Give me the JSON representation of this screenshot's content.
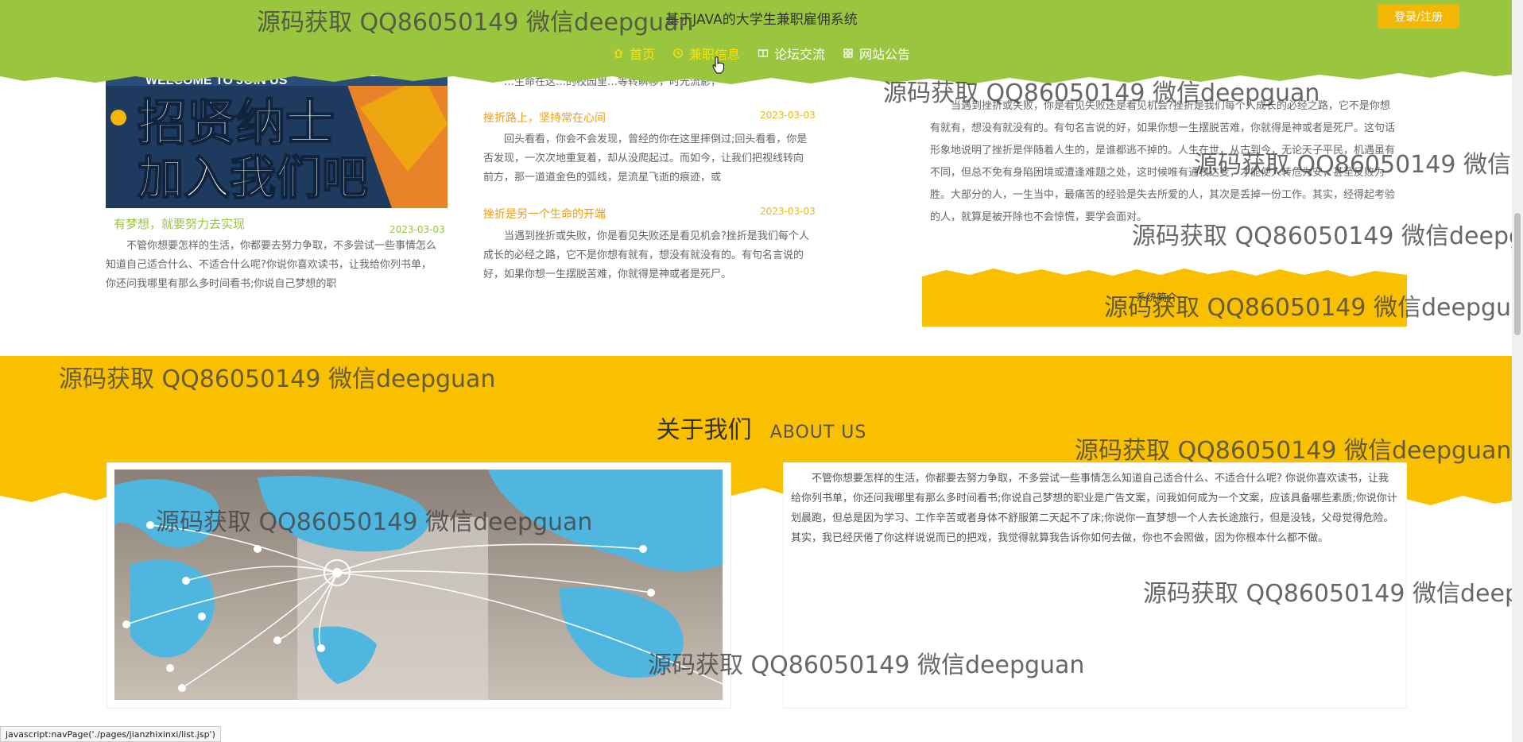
{
  "header": {
    "title": "基于JAVA的大学生兼职雇佣系统",
    "login_label": "登录/注册",
    "nav": [
      {
        "label": "首页",
        "icon": "home-icon"
      },
      {
        "label": "兼职信息",
        "icon": "clock-icon"
      },
      {
        "label": "论坛交流",
        "icon": "book-icon"
      },
      {
        "label": "网站公告",
        "icon": "grid-icon"
      }
    ],
    "active_nav": 1
  },
  "featured": {
    "image_text_top": "WELCOME TO JOIN US",
    "image_text_line1": "招贤纳士",
    "image_text_line2": "加入我们吧",
    "title": "有梦想，就要努力去实现",
    "date": "2023-03-03",
    "text": "不管你想要怎样的生活，你都要去努力争取，不多尝试一些事情怎么知道自己适合什么、不适合什么呢?你说你喜欢读书，让我给你列书单，你还问我哪里有那么多时间看书;你说自己梦想的职"
  },
  "news": [
    {
      "title": "",
      "date": "",
      "text": "…生命在这…的校园里…等转瞬移，时光流影，"
    },
    {
      "title": "挫折路上，坚持常在心间",
      "date": "2023-03-03",
      "text": "回头看看，你会不会发现，曾经的你在这里摔倒过;回头看看，你是否发现，一次次地重复着，却从没爬起过。而如今，让我们把视线转向前方，那一道道金色的弧线，是流星飞逝的痕迹，或"
    },
    {
      "title": "挫折是另一个生命的开端",
      "date": "2023-03-03",
      "text": "当遇到挫折或失败，你是看见失败还是看见机会?挫折是我们每个人成长的必经之路，它不是你想有就有，想没有就没有的。有句名言说的好，如果你想一生摆脱苦难，你就得是神或者是死尸。"
    }
  ],
  "story": {
    "text": "当遇到挫折或失败，你是看见失败还是看见机会?挫折是我们每个人成长的必经之路，它不是你想有就有，想没有就没有的。有句名言说的好，如果你想一生摆脱苦难，你就得是神或者是死尸。这句话形象地说明了挫折是伴随着人生的，是谁都逃不掉的。人生在世，从古到今，无论天子平民，机遇虽有不同，但总不免有身陷困境或遭逢难题之处，这时候唯有通权达变，才能使人转危为安，甚至反败为胜。大部分的人，一生当中，最痛苦的经验是失去所爱的人，其次是丢掉一份工作。其实，经得起考验的人，就算是被开除也不会惊慌，要学会面对。",
    "button_label": "系统简介"
  },
  "about": {
    "title_cn": "关于我们",
    "title_en": "ABOUT US",
    "text": "不管你想要怎样的生活，你都要去努力争取，不多尝试一些事情怎么知道自己适合什么、不适合什么呢? 你说你喜欢读书，让我给你列书单，你还问我哪里有那么多时间看书;你说自己梦想的职业是广告文案，问我如何成为一个文案，应该具备哪些素质;你说你计划晨跑，但总是因为学习、工作辛苦或者身体不舒服第二天起不了床;你说你一直梦想一个人去长途旅行，但是没钱，父母觉得危险。其实，我已经厌倦了你这样说说而已的把戏，我觉得就算我告诉你如何去做，你也不会照做，因为你根本什么都不做。"
  },
  "watermark": "源码获取 QQ86050149 微信deepguan",
  "status_url": "javascript:navPage('./pages/jianzhixinxi/list.jsp')",
  "colors": {
    "header_green": "#9ac53f",
    "accent_yellow": "#f9c000",
    "login_orange": "#f2b705",
    "active_nav": "#ffe200",
    "news_title_orange": "#f39c12"
  }
}
